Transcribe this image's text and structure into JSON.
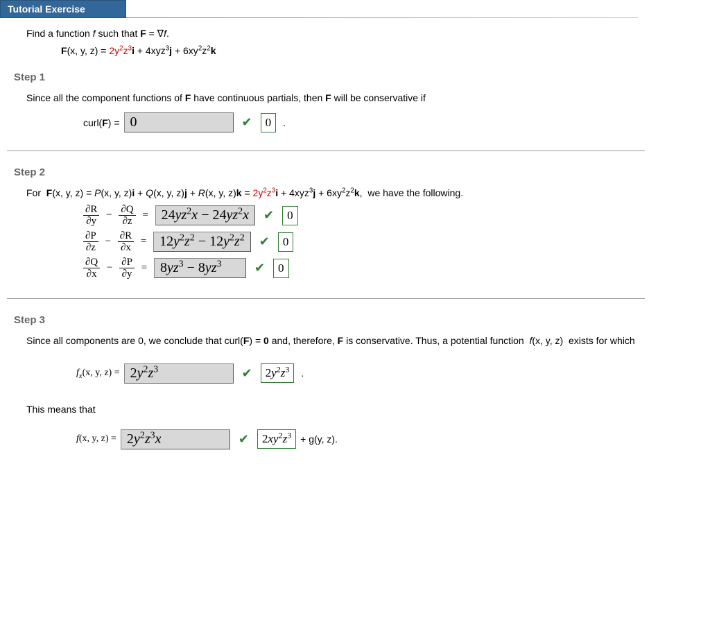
{
  "header": {
    "title": "Tutorial Exercise"
  },
  "exercise": {
    "prompt": "Find a function f such that F = ∇f.",
    "F_lhs": "F(x, y, z) =",
    "F_term1": "2y²z³",
    "F_i": "i",
    "F_plus1": " + 4xyz³",
    "F_j": "j",
    "F_plus2": " + 6xy²z²",
    "F_k": "k"
  },
  "step1": {
    "label": "Step 1",
    "text_a": "Since all the component functions of ",
    "F": "F",
    "text_b": " have continuous partials, then ",
    "text_c": " will be conservative if",
    "curl_lhs": "curl(F) =",
    "input": "0",
    "answer": "0"
  },
  "step2": {
    "label": "Step 2",
    "line_a": "For  ",
    "Fxyz": "F(x, y, z) = P(x, y, z)i + Q(x, y, z)j + R(x, y, z)k",
    "eq": " = ",
    "term1": "2y²z³",
    "i": "i",
    "p1": " + 4xyz³",
    "j": "j",
    "p2": " + 6xy²z²",
    "k": "k",
    "line_b": ",  we have the following.",
    "rows": [
      {
        "num1": "∂R",
        "den1": "∂y",
        "num2": "∂Q",
        "den2": "∂z",
        "input": "24yz²x − 24yz²x",
        "ans": "0"
      },
      {
        "num1": "∂P",
        "den1": "∂z",
        "num2": "∂R",
        "den2": "∂x",
        "input": "12y²z² − 12y²z²",
        "ans": "0"
      },
      {
        "num1": "∂Q",
        "den1": "∂x",
        "num2": "∂P",
        "den2": "∂y",
        "input": "8yz³ − 8yz³",
        "ans": "0"
      }
    ]
  },
  "step3": {
    "label": "Step 3",
    "para1_a": "Since all components are 0, we conclude that curl(",
    "para1_b": ") = ",
    "zero_bold": "0",
    "para1_c": " and, therefore, ",
    "para1_d": " is conservative. Thus, a potential function  f(x, y, z)  exists for which",
    "fx_lhs": "fₓ(x, y, z) =",
    "fx_input": "2y²z³",
    "fx_ans": "2y²z³",
    "means": "This means that",
    "f_lhs": "f(x, y, z) =",
    "f_input": "2y²z³x",
    "f_ans": "2xy²z³",
    "plus_g": " + g(y, z)."
  }
}
